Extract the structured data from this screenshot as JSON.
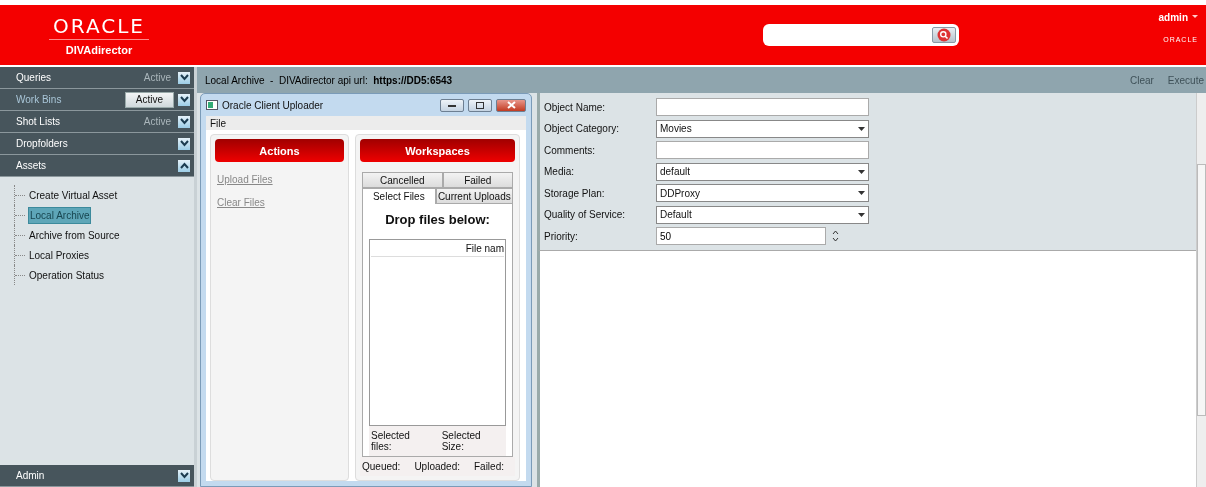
{
  "header": {
    "brand": "ORACLE",
    "product": "DIVAdirector",
    "user": "admin",
    "small_brand": "ORACLE"
  },
  "sidebar": {
    "sections": [
      {
        "label": "Queries",
        "active": {
          "label": "Active",
          "selected": false
        },
        "expanded": false
      },
      {
        "label": "Work Bins",
        "active": {
          "label": "Active",
          "selected": true
        },
        "expanded": false
      },
      {
        "label": "Shot Lists",
        "active": {
          "label": "Active",
          "selected": false
        },
        "expanded": false
      },
      {
        "label": "Dropfolders",
        "expanded": false
      },
      {
        "label": "Assets",
        "expanded": true,
        "children": [
          {
            "label": "Create Virtual Asset",
            "selected": false
          },
          {
            "label": "Local Archive",
            "selected": true
          },
          {
            "label": "Archive from Source",
            "selected": false
          },
          {
            "label": "Local Proxies",
            "selected": false
          },
          {
            "label": "Operation Status",
            "selected": false
          }
        ]
      }
    ],
    "footer": {
      "label": "Admin",
      "expanded": false
    }
  },
  "toolbar": {
    "title": "Local Archive  -  DIVAdirector api url:  **https://DD5:6543**",
    "actions": [
      {
        "label": "Clear",
        "disabled": true
      },
      {
        "label": "Execute",
        "disabled": true
      }
    ]
  },
  "uploader": {
    "title": "Oracle Client Uploader",
    "menu": [
      "File"
    ],
    "actions": {
      "heading": "Actions",
      "links": [
        {
          "label": "Upload Files",
          "disabled": true
        },
        {
          "label": "Clear Files",
          "disabled": true
        }
      ]
    },
    "workspaces": {
      "heading": "Workspaces",
      "tab_rows": [
        [
          {
            "label": "Cancelled",
            "selected": false
          },
          {
            "label": "Failed",
            "selected": false
          }
        ],
        [
          {
            "label": "Select Files",
            "selected": true
          },
          {
            "label": "Current Uploads",
            "selected": false
          }
        ]
      ],
      "drop_heading": "Drop files below:",
      "columns": [
        "File nam"
      ],
      "selection_summary": [
        "Selected files:",
        "Selected Size:"
      ],
      "status_summary": [
        "Queued:",
        "Uploaded:",
        "Failed:"
      ]
    }
  },
  "form": {
    "fields": [
      {
        "label": "Object Name:",
        "kind": "text"
      },
      {
        "label": "Object Category:",
        "kind": "select",
        "value": "Movies"
      },
      {
        "label": "Comments:",
        "kind": "text"
      },
      {
        "label": "Media:",
        "kind": "select",
        "value": "default"
      },
      {
        "label": "Storage Plan:",
        "kind": "select",
        "value": "DDProxy"
      },
      {
        "label": "Quality of Service:",
        "kind": "select",
        "value": "Default"
      },
      {
        "label": "Priority:",
        "kind": "spinner",
        "value": "50"
      }
    ]
  }
}
